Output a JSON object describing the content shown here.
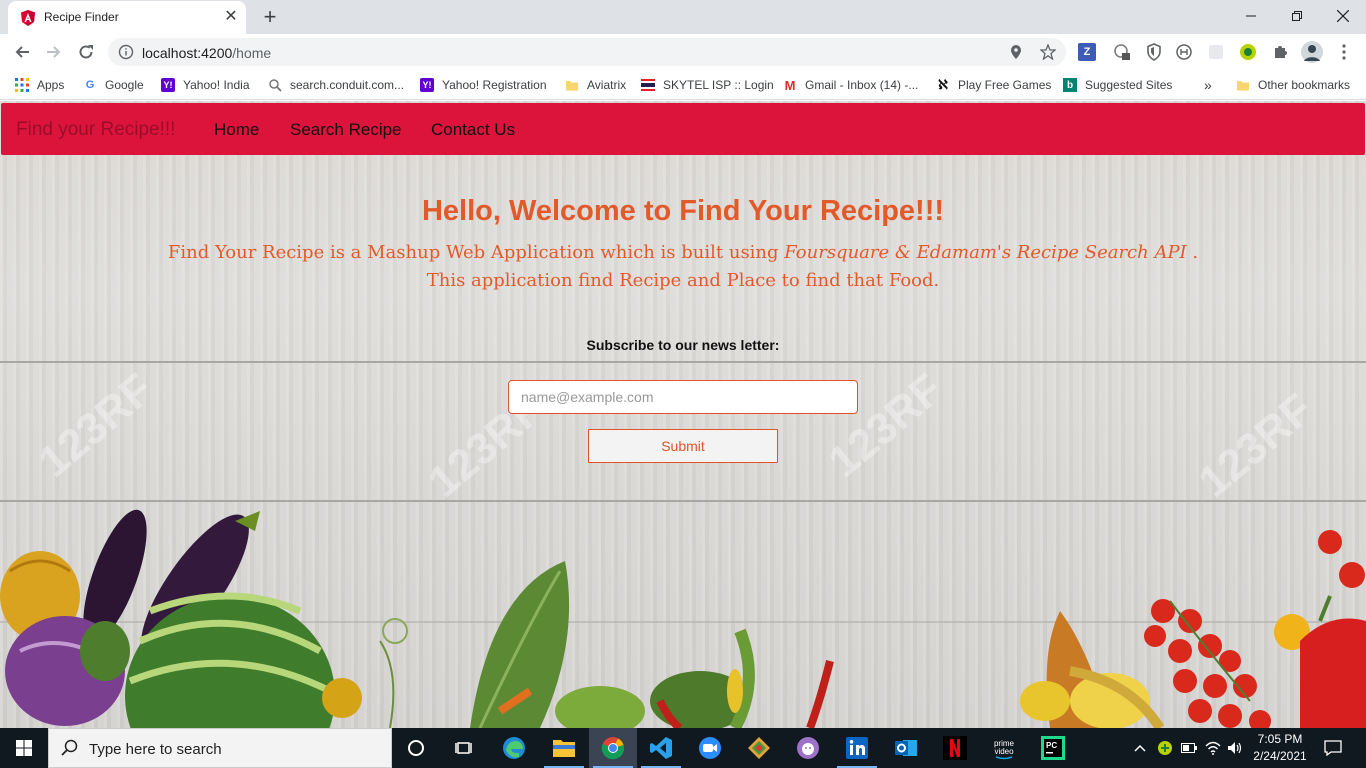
{
  "browser": {
    "tab_title": "Recipe Finder",
    "url_host": "localhost:4200",
    "url_path": "/home",
    "new_tab_symbol": "+",
    "close_tab_symbol": "✕"
  },
  "bookmarks": [
    {
      "label": "Apps",
      "icon": "apps-grid-icon"
    },
    {
      "label": "Google",
      "icon": "google-icon"
    },
    {
      "label": "Yahoo! India",
      "icon": "yahoo-icon"
    },
    {
      "label": "search.conduit.com...",
      "icon": "search-icon"
    },
    {
      "label": "Yahoo! Registration",
      "icon": "yahoo-icon"
    },
    {
      "label": "Aviatrix",
      "icon": "folder-icon"
    },
    {
      "label": "SKYTEL ISP :: Login",
      "icon": "flag-icon"
    },
    {
      "label": "Gmail - Inbox (14) -...",
      "icon": "gmail-icon"
    },
    {
      "label": "Play Free Games",
      "icon": "games-icon"
    },
    {
      "label": "Suggested Sites",
      "icon": "bing-icon"
    },
    {
      "label": "Other bookmarks",
      "icon": "folder-icon"
    }
  ],
  "bookmarks_overflow": "»",
  "navbar": {
    "brand": "Find your Recipe!!!",
    "links": [
      "Home",
      "Search Recipe",
      "Contact Us"
    ],
    "color": "#dc143c"
  },
  "hero": {
    "welcome_prefix": "Hello, Welcome to ",
    "welcome_bold": "Find Your Recipe!!!",
    "desc_part1": "Find Your Recipe is a Mashup Web Application which is built using ",
    "desc_italic": "Foursquare & Edamam's Recipe Search API",
    "desc_part2": " . This application find Recipe and Place to find that Food.",
    "accent_color": "#e25a2a"
  },
  "subscribe": {
    "label": "Subscribe to our news letter:",
    "email_placeholder": "name@example.com",
    "email_value": "",
    "submit_label": "Submit"
  },
  "watermark": "123RF",
  "taskbar": {
    "search_placeholder": "Type here to search",
    "time": "7:05 PM",
    "date": "2/24/2021",
    "apps": [
      "cortana-icon",
      "task-view-icon",
      "edge-icon",
      "file-explorer-icon",
      "chrome-icon",
      "vscode-icon",
      "zoom-icon",
      "git-icon",
      "github-desktop-icon",
      "linkedin-icon",
      "outlook-icon",
      "netflix-icon",
      "prime-video-icon",
      "pycharm-icon"
    ]
  }
}
